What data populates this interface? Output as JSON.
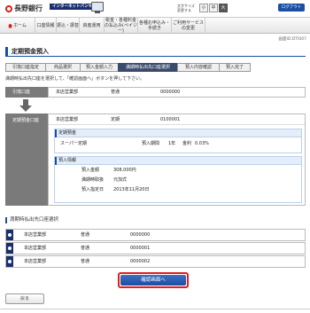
{
  "header": {
    "bank_name": "長野銀行",
    "service_name": "インターネットバンキング",
    "font_size_label": "文字サイズ 変更する",
    "font_small": "小",
    "font_medium": "中",
    "font_large": "大",
    "logout_label": "ログアウト"
  },
  "nav": {
    "home": "ホーム",
    "items": [
      "口座情報",
      "振込・振替",
      "資産運用",
      "税金・各種料金の払込み(ペイジー)",
      "各種お申込み・手続き",
      "ご利用サービスの変更"
    ]
  },
  "screen_id": "画面ID:DTI007",
  "page_title": "定期預金預入",
  "steps": [
    "引落口座指定",
    "商品選択",
    "預入金額入力",
    "満期時払出先口座選択",
    "預入内容確認",
    "預入完了"
  ],
  "active_step_index": 3,
  "instruction": "満期時払出先口座を選択して、「確認画面へ」ボタンを押して下さい。",
  "debit": {
    "label": "引落口座",
    "branch": "本店営業部",
    "type": "普通",
    "number": "0000000"
  },
  "credit": {
    "label": "定期預金口座",
    "branch": "本店営業部",
    "type": "定期",
    "number": "0100001",
    "deposit_section_title": "定期預金",
    "product_name": "スーパー定期",
    "period_label": "預入期間",
    "period_value": "1年",
    "rate_label": "金利",
    "rate_value": "0.03%",
    "info_section_title": "預入情報",
    "amount_label": "預入金額",
    "amount_value": "308,000円",
    "maturity_label": "満期時取扱",
    "maturity_value": "元加式",
    "date_label": "預入指定日",
    "date_value": "2013年11月20日"
  },
  "destination": {
    "title": "満期時払出先口座選択",
    "accounts": [
      {
        "branch": "本店営業部",
        "type": "普通",
        "number": "0000000"
      },
      {
        "branch": "本店営業部",
        "type": "普通",
        "number": "0000001"
      },
      {
        "branch": "本店営業部",
        "type": "普通",
        "number": "0000002"
      }
    ]
  },
  "buttons": {
    "confirm": "確認画面へ",
    "back": "戻る"
  }
}
